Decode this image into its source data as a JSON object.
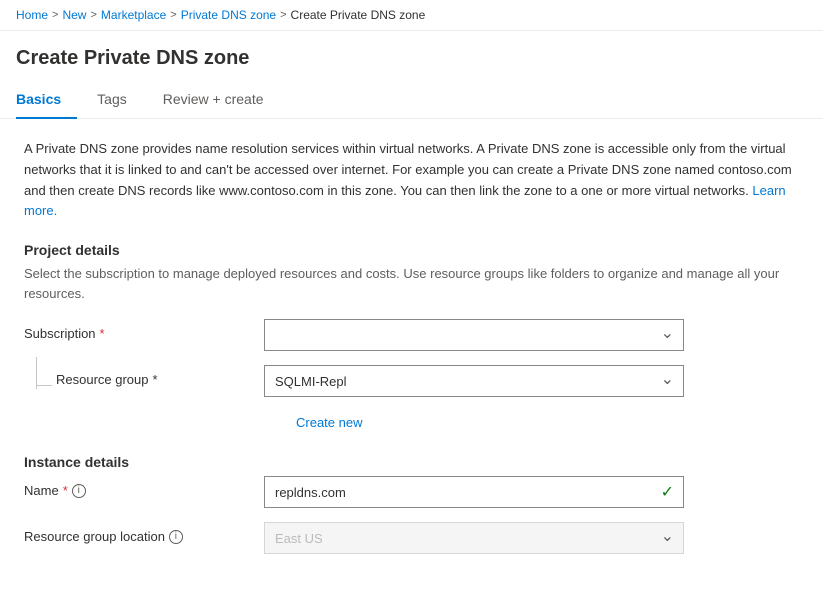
{
  "breadcrumb": {
    "items": [
      {
        "label": "Home",
        "link": true
      },
      {
        "label": "New",
        "link": true
      },
      {
        "label": "Marketplace",
        "link": true
      },
      {
        "label": "Private DNS zone",
        "link": true
      },
      {
        "label": "Create Private DNS zone",
        "link": false
      }
    ]
  },
  "page": {
    "title": "Create Private DNS zone"
  },
  "tabs": [
    {
      "label": "Basics",
      "active": true
    },
    {
      "label": "Tags",
      "active": false
    },
    {
      "label": "Review + create",
      "active": false
    }
  ],
  "description": {
    "text": "A Private DNS zone provides name resolution services within virtual networks. A Private DNS zone is accessible only from the virtual networks that it is linked to and can't be accessed over internet. For example you can create a Private DNS zone named contoso.com and then create DNS records like www.contoso.com in this zone. You can then link the zone to a one or more virtual networks.",
    "learn_more": "Learn more."
  },
  "project_details": {
    "title": "Project details",
    "subtitle": "Select the subscription to manage deployed resources and costs. Use resource groups like folders to organize and manage all your resources.",
    "subscription": {
      "label": "Subscription",
      "required": true,
      "value": "",
      "placeholder": ""
    },
    "resource_group": {
      "label": "Resource group",
      "required": true,
      "value": "SQLMI-Repl",
      "placeholder": ""
    },
    "create_new": "Create new"
  },
  "instance_details": {
    "title": "Instance details",
    "name": {
      "label": "Name",
      "required": true,
      "has_info": true,
      "value": "repldns.com",
      "valid": true
    },
    "resource_group_location": {
      "label": "Resource group location",
      "has_info": true,
      "value": "East US",
      "disabled": true
    }
  }
}
